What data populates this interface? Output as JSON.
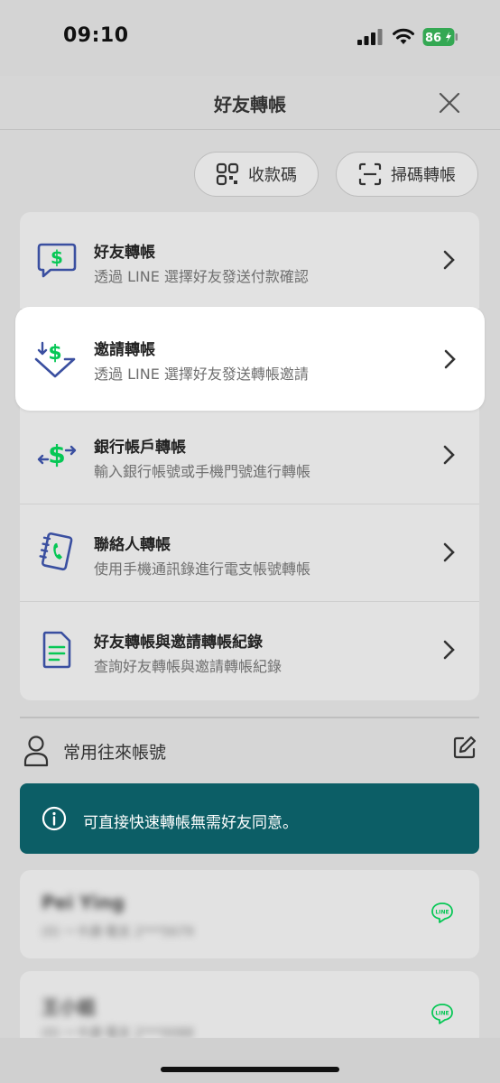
{
  "status": {
    "time": "09:10",
    "battery": "86"
  },
  "header": {
    "title": "好友轉帳"
  },
  "actions": {
    "receive_label": "收款碼",
    "scan_label": "掃碼轉帳"
  },
  "menu": [
    {
      "title": "好友轉帳",
      "subtitle": "透過 LINE 選擇好友發送付款確認"
    },
    {
      "title": "邀請轉帳",
      "subtitle": "透過 LINE 選擇好友發送轉帳邀請"
    },
    {
      "title": "銀行帳戶轉帳",
      "subtitle": "輸入銀行帳號或手機門號進行轉帳"
    },
    {
      "title": "聯絡人轉帳",
      "subtitle": "使用手機通訊錄進行電支帳號轉帳"
    },
    {
      "title": "好友轉帳與邀請轉帳紀錄",
      "subtitle": "查詢好友轉帳與邀請轉帳紀錄"
    }
  ],
  "frequent": {
    "label": "常用往來帳號"
  },
  "banner": {
    "text": "可直接快速轉帳無需好友同意。"
  },
  "contacts": [
    {
      "name": "Pei Ying",
      "account": "(0) 一卡通·電支 2***5679"
    },
    {
      "name": "王小姐",
      "account": "(0) 一卡通·電支 2***0088"
    }
  ],
  "colors": {
    "accent_green": "#06c755",
    "icon_blue": "#3a4fa0",
    "banner_teal": "#0c5e66"
  }
}
